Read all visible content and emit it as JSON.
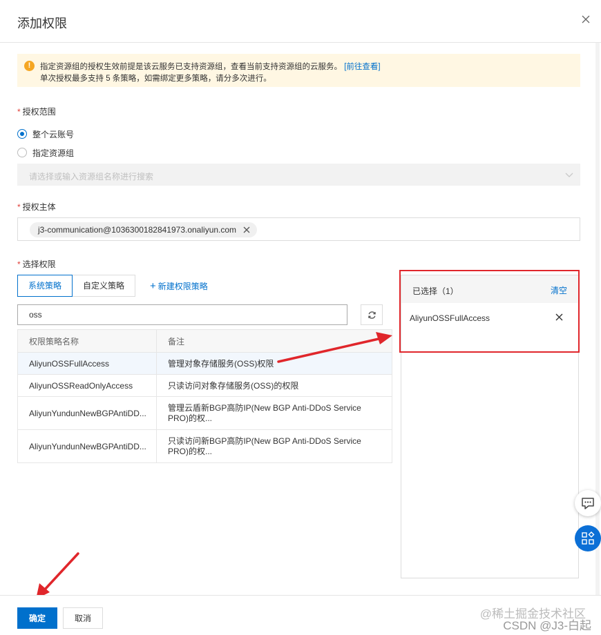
{
  "dialog": {
    "title": "添加权限"
  },
  "notice": {
    "icon": "warning-icon",
    "line1": "指定资源组的授权生效前提是该云服务已支持资源组，查看当前支持资源组的云服务。",
    "link": "[前往查看]",
    "line2": "单次授权最多支持 5 条策略，如需绑定更多策略，请分多次进行。"
  },
  "scope": {
    "label": "授权范围",
    "options": [
      "整个云账号",
      "指定资源组"
    ],
    "selected": "整个云账号",
    "resource_group_placeholder": "请选择或输入资源组名称进行搜索"
  },
  "principal": {
    "label": "授权主体",
    "tag": "j3-communication@1036300182841973.onaliyun.com"
  },
  "permissions": {
    "label": "选择权限",
    "tabs": [
      "系统策略",
      "自定义策略"
    ],
    "active_tab": "系统策略",
    "new_policy": "新建权限策略",
    "search_value": "oss",
    "table": {
      "headers": [
        "权限策略名称",
        "备注"
      ],
      "rows": [
        {
          "name": "AliyunOSSFullAccess",
          "note": "管理对象存储服务(OSS)权限",
          "selected": true
        },
        {
          "name": "AliyunOSSReadOnlyAccess",
          "note": "只读访问对象存储服务(OSS)的权限",
          "selected": false
        },
        {
          "name": "AliyunYundunNewBGPAntiDD...",
          "note": "管理云盾新BGP高防IP(New BGP Anti-DDoS Service PRO)的权...",
          "selected": false
        },
        {
          "name": "AliyunYundunNewBGPAntiDD...",
          "note": "只读访问新BGP高防IP(New BGP Anti-DDoS Service PRO)的权...",
          "selected": false
        }
      ]
    }
  },
  "selected_panel": {
    "title": "已选择（1）",
    "clear": "清空",
    "items": [
      "AliyunOSSFullAccess"
    ]
  },
  "footer": {
    "ok": "确定",
    "cancel": "取消"
  },
  "watermark": {
    "line1": "@稀土掘金技术社区",
    "line2": "CSDN @J3-白起"
  },
  "colors": {
    "accent": "#0070cc",
    "annotation_red": "#e0262b",
    "notice_bg": "#fff7e3"
  }
}
